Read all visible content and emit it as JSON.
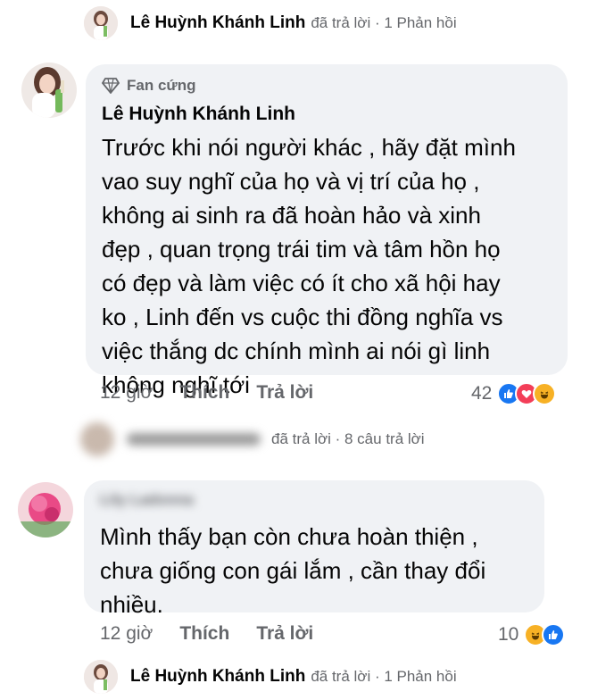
{
  "top_reply": {
    "name": "Lê Huỳnh Khánh Linh",
    "meta": "đã trả lời · 1 Phản hồi"
  },
  "comment1": {
    "badge": "Fan cứng",
    "author": "Lê Huỳnh Khánh Linh",
    "lines": [
      "Trước khi nói người khác , hãy đặt mình",
      "vao suy nghĩ của họ và vị trí của họ ,",
      "không ai sinh ra đã hoàn hảo và xinh",
      "đẹp , quan trọng trái tim và tâm hồn họ",
      "có đẹp và làm việc có ít cho xã hội hay",
      "ko , Linh đến vs cuộc thi đồng nghĩa vs",
      "việc thắng dc chính mình ai nói gì linh",
      "không nghĩ tới"
    ],
    "time": "12 giờ",
    "like": "Thích",
    "reply": "Trả lời",
    "reaction_count": "42",
    "reactions": [
      "like-icon",
      "love-icon",
      "haha-icon"
    ]
  },
  "middle_reply": {
    "name_blurred": "người dùng ẩn danh",
    "meta": "đã trả lời · 8 câu trả lời"
  },
  "comment2": {
    "author": "Lily Ladonna",
    "lines": [
      "Mình thấy bạn còn chưa hoàn thiện ,",
      "chưa giống con gái lắm , cần thay đổi",
      "nhiều."
    ],
    "time": "12 giờ",
    "like": "Thích",
    "reply": "Trả lời",
    "reaction_count": "10",
    "reactions": [
      "haha-icon",
      "like-icon"
    ]
  },
  "bottom_reply": {
    "name": "Lê Huỳnh Khánh Linh",
    "meta": "đã trả lời · 1 Phản hồi"
  }
}
